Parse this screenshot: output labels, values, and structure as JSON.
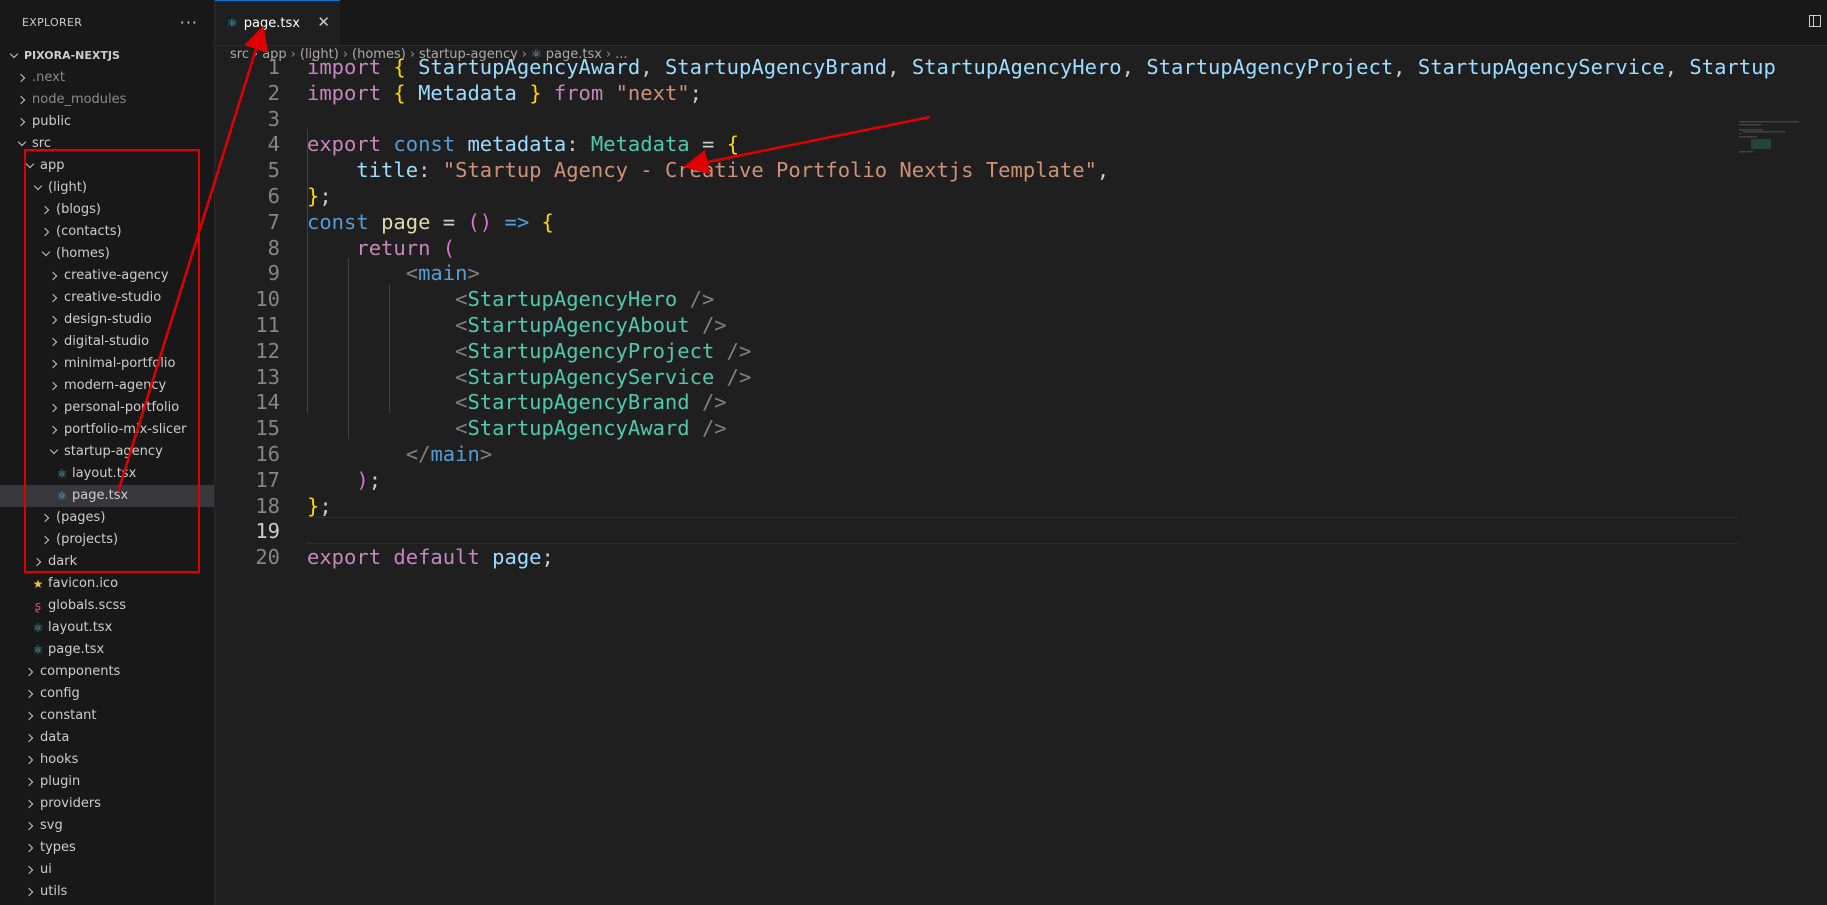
{
  "explorer": {
    "title": "EXPLORER",
    "more_label": "···",
    "tree": [
      {
        "label": "PIXORA-NEXTJS",
        "depth": 0,
        "state": "open",
        "kind": "root"
      },
      {
        "label": ".next",
        "depth": 1,
        "state": "closed",
        "kind": "folder",
        "dim": true
      },
      {
        "label": "node_modules",
        "depth": 1,
        "state": "closed",
        "kind": "folder",
        "dim": true
      },
      {
        "label": "public",
        "depth": 1,
        "state": "closed",
        "kind": "folder"
      },
      {
        "label": "src",
        "depth": 1,
        "state": "open",
        "kind": "folder"
      },
      {
        "label": "app",
        "depth": 2,
        "state": "open",
        "kind": "folder"
      },
      {
        "label": "(light)",
        "depth": 3,
        "state": "open",
        "kind": "folder"
      },
      {
        "label": "(blogs)",
        "depth": 4,
        "state": "closed",
        "kind": "folder"
      },
      {
        "label": "(contacts)",
        "depth": 4,
        "state": "closed",
        "kind": "folder"
      },
      {
        "label": "(homes)",
        "depth": 4,
        "state": "open",
        "kind": "folder"
      },
      {
        "label": "creative-agency",
        "depth": 5,
        "state": "closed",
        "kind": "folder"
      },
      {
        "label": "creative-studio",
        "depth": 5,
        "state": "closed",
        "kind": "folder"
      },
      {
        "label": "design-studio",
        "depth": 5,
        "state": "closed",
        "kind": "folder"
      },
      {
        "label": "digital-studio",
        "depth": 5,
        "state": "closed",
        "kind": "folder"
      },
      {
        "label": "minimal-portfolio",
        "depth": 5,
        "state": "closed",
        "kind": "folder"
      },
      {
        "label": "modern-agency",
        "depth": 5,
        "state": "closed",
        "kind": "folder"
      },
      {
        "label": "personal-portfolio",
        "depth": 5,
        "state": "closed",
        "kind": "folder"
      },
      {
        "label": "portfolio-mix-slicer",
        "depth": 5,
        "state": "closed",
        "kind": "folder"
      },
      {
        "label": "startup-agency",
        "depth": 5,
        "state": "open",
        "kind": "folder"
      },
      {
        "label": "layout.tsx",
        "depth": 6,
        "state": "file",
        "kind": "react"
      },
      {
        "label": "page.tsx",
        "depth": 6,
        "state": "file",
        "kind": "react",
        "selected": true
      },
      {
        "label": "(pages)",
        "depth": 4,
        "state": "closed",
        "kind": "folder"
      },
      {
        "label": "(projects)",
        "depth": 4,
        "state": "closed",
        "kind": "folder"
      },
      {
        "label": "dark",
        "depth": 3,
        "state": "closed",
        "kind": "folder"
      },
      {
        "label": "favicon.ico",
        "depth": 3,
        "state": "file",
        "kind": "star"
      },
      {
        "label": "globals.scss",
        "depth": 3,
        "state": "file",
        "kind": "sass"
      },
      {
        "label": "layout.tsx",
        "depth": 3,
        "state": "file",
        "kind": "react"
      },
      {
        "label": "page.tsx",
        "depth": 3,
        "state": "file",
        "kind": "react"
      },
      {
        "label": "components",
        "depth": 2,
        "state": "closed",
        "kind": "folder"
      },
      {
        "label": "config",
        "depth": 2,
        "state": "closed",
        "kind": "folder"
      },
      {
        "label": "constant",
        "depth": 2,
        "state": "closed",
        "kind": "folder"
      },
      {
        "label": "data",
        "depth": 2,
        "state": "closed",
        "kind": "folder"
      },
      {
        "label": "hooks",
        "depth": 2,
        "state": "closed",
        "kind": "folder"
      },
      {
        "label": "plugin",
        "depth": 2,
        "state": "closed",
        "kind": "folder"
      },
      {
        "label": "providers",
        "depth": 2,
        "state": "closed",
        "kind": "folder"
      },
      {
        "label": "svg",
        "depth": 2,
        "state": "closed",
        "kind": "folder"
      },
      {
        "label": "types",
        "depth": 2,
        "state": "closed",
        "kind": "folder"
      },
      {
        "label": "ui",
        "depth": 2,
        "state": "closed",
        "kind": "folder"
      },
      {
        "label": "utils",
        "depth": 2,
        "state": "closed",
        "kind": "folder"
      }
    ]
  },
  "tab": {
    "label": "page.tsx",
    "icon": "react-icon",
    "close": "✕"
  },
  "breadcrumb": [
    "src",
    "app",
    "(light)",
    "(homes)",
    "startup-agency",
    "page.tsx",
    "..."
  ],
  "editor": {
    "active_line": 19,
    "lines": [
      [
        [
          "k-purple",
          "import"
        ],
        [
          "",
          " "
        ],
        [
          "b1",
          "{"
        ],
        [
          "",
          " "
        ],
        [
          "v-light",
          "StartupAgencyAward"
        ],
        [
          "",
          ", "
        ],
        [
          "v-light",
          "StartupAgencyBrand"
        ],
        [
          "",
          ", "
        ],
        [
          "v-light",
          "StartupAgencyHero"
        ],
        [
          "",
          ", "
        ],
        [
          "v-light",
          "StartupAgencyProject"
        ],
        [
          "",
          ", "
        ],
        [
          "v-light",
          "StartupAgencyService"
        ],
        [
          "",
          ", "
        ],
        [
          "v-light",
          "Startup"
        ]
      ],
      [
        [
          "k-purple",
          "import"
        ],
        [
          "",
          " "
        ],
        [
          "b1",
          "{"
        ],
        [
          "",
          " "
        ],
        [
          "v-light",
          "Metadata"
        ],
        [
          "",
          " "
        ],
        [
          "b1",
          "}"
        ],
        [
          "",
          " "
        ],
        [
          "k-purple",
          "from"
        ],
        [
          "",
          " "
        ],
        [
          "str",
          "\"next\""
        ],
        [
          "",
          ";"
        ]
      ],
      [],
      [
        [
          "k-purple",
          "export"
        ],
        [
          "",
          " "
        ],
        [
          "k-blue",
          "const"
        ],
        [
          "",
          " "
        ],
        [
          "v-light",
          "metadata"
        ],
        [
          "",
          ": "
        ],
        [
          "t-cyan",
          "Metadata"
        ],
        [
          "",
          " = "
        ],
        [
          "b1",
          "{"
        ]
      ],
      [
        [
          "",
          "    "
        ],
        [
          "v-light",
          "title"
        ],
        [
          "",
          ": "
        ],
        [
          "str",
          "\"Startup Agency - Creative Portfolio Nextjs Template\""
        ],
        [
          "",
          ","
        ]
      ],
      [
        [
          "b1",
          "}"
        ],
        [
          "",
          ";"
        ]
      ],
      [
        [
          "k-blue",
          "const"
        ],
        [
          "",
          " "
        ],
        [
          "v-yellow",
          "page"
        ],
        [
          "",
          " = "
        ],
        [
          "b2",
          "()"
        ],
        [
          "",
          " "
        ],
        [
          "k-blue",
          "=>"
        ],
        [
          "",
          " "
        ],
        [
          "b1",
          "{"
        ]
      ],
      [
        [
          "",
          "    "
        ],
        [
          "k-purple",
          "return"
        ],
        [
          "",
          " "
        ],
        [
          "b2",
          "("
        ]
      ],
      [
        [
          "",
          "        "
        ],
        [
          "tagb",
          "<"
        ],
        [
          "tagn",
          "main"
        ],
        [
          "tagb",
          ">"
        ]
      ],
      [
        [
          "",
          "            "
        ],
        [
          "tagb",
          "<"
        ],
        [
          "t-cyan",
          "StartupAgencyHero"
        ],
        [
          "tagb",
          " />"
        ]
      ],
      [
        [
          "",
          "            "
        ],
        [
          "tagb",
          "<"
        ],
        [
          "t-cyan",
          "StartupAgencyAbout"
        ],
        [
          "tagb",
          " />"
        ]
      ],
      [
        [
          "",
          "            "
        ],
        [
          "tagb",
          "<"
        ],
        [
          "t-cyan",
          "StartupAgencyProject"
        ],
        [
          "tagb",
          " />"
        ]
      ],
      [
        [
          "",
          "            "
        ],
        [
          "tagb",
          "<"
        ],
        [
          "t-cyan",
          "StartupAgencyService"
        ],
        [
          "tagb",
          " />"
        ]
      ],
      [
        [
          "",
          "            "
        ],
        [
          "tagb",
          "<"
        ],
        [
          "t-cyan",
          "StartupAgencyBrand"
        ],
        [
          "tagb",
          " />"
        ]
      ],
      [
        [
          "",
          "            "
        ],
        [
          "tagb",
          "<"
        ],
        [
          "t-cyan",
          "StartupAgencyAward"
        ],
        [
          "tagb",
          " />"
        ]
      ],
      [
        [
          "",
          "        "
        ],
        [
          "tagb",
          "</"
        ],
        [
          "tagn",
          "main"
        ],
        [
          "tagb",
          ">"
        ]
      ],
      [
        [
          "",
          "    "
        ],
        [
          "b2",
          ")"
        ],
        [
          "",
          ";"
        ]
      ],
      [
        [
          "b1",
          "}"
        ],
        [
          "",
          ";"
        ]
      ],
      [],
      [
        [
          "k-purple",
          "export"
        ],
        [
          "",
          " "
        ],
        [
          "k-purple",
          "default"
        ],
        [
          "",
          " "
        ],
        [
          "v-light",
          "page"
        ],
        [
          "",
          ";"
        ]
      ]
    ]
  },
  "minimap_fragment": "gencyA",
  "colors": {
    "annotation": "#e00000",
    "accent": "#0078d4",
    "react_icon": "#4fb6e8"
  }
}
